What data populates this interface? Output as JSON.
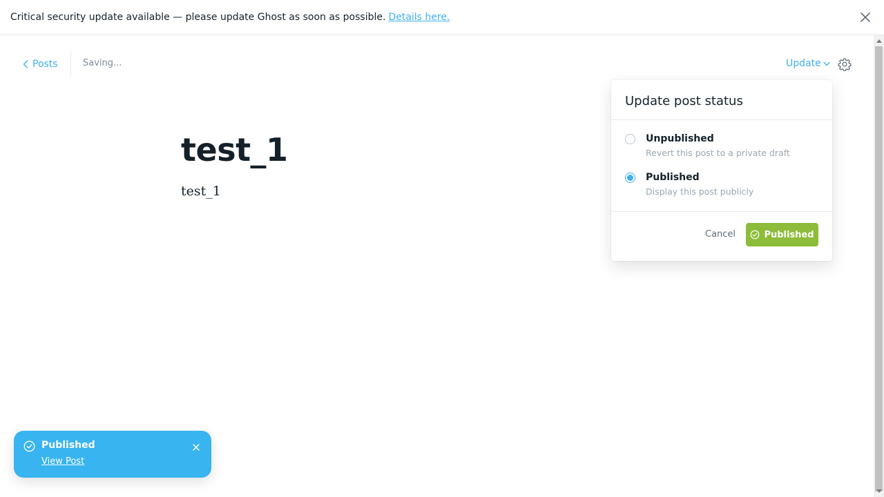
{
  "banner": {
    "message": "Critical security update available — please update Ghost as soon as possible.",
    "link_text": "Details here."
  },
  "editor": {
    "back_label": "Posts",
    "status": "Saving...",
    "update_label": "Update"
  },
  "post": {
    "title": "test_1",
    "body": "test_1"
  },
  "status_panel": {
    "title": "Update post status",
    "options": [
      {
        "label": "Unpublished",
        "description": "Revert this post to a private draft",
        "selected": false
      },
      {
        "label": "Published",
        "description": "Display this post publicly",
        "selected": true
      }
    ],
    "cancel_label": "Cancel",
    "confirm_label": "Published"
  },
  "toast": {
    "title": "Published",
    "link_text": "View Post"
  },
  "colors": {
    "accent_blue": "#3eb0ef",
    "confirm_green": "#8dbc3a",
    "toast_blue": "#38b4f0"
  }
}
